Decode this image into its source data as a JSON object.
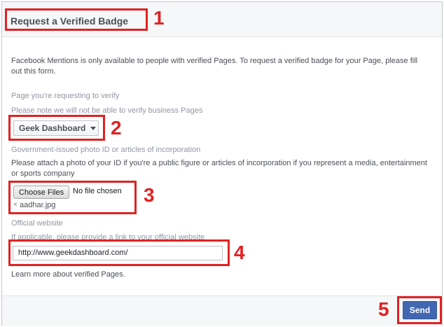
{
  "dialog": {
    "title": "Request a Verified Badge",
    "intro": "Facebook Mentions is only available to people with verified Pages. To request a verified badge for your Page, please fill out this form."
  },
  "page_section": {
    "heading": "Page you're requesting to verify",
    "note": "Please note we will not be able to verify business Pages",
    "selected_page": "Geek Dashboard"
  },
  "id_section": {
    "heading": "Government-issued photo ID or articles of incorporation",
    "note": "Please attach a photo of your ID if you're a public figure or articles of incorporation if you represent a media, entertainment or sports company",
    "choose_label": "Choose Files",
    "no_file_text": "No file chosen",
    "remove_glyph": "×",
    "attached_file": "aadhar.jpg"
  },
  "website_section": {
    "heading": "Official website",
    "note": "If applicable, please provide a link to your official website",
    "url_value": "http://www.geekdashboard.com/",
    "learn_more": "Learn more about verified Pages."
  },
  "footer": {
    "send_label": "Send"
  },
  "annotations": {
    "numbers": [
      "1",
      "2",
      "3",
      "4",
      "5"
    ],
    "color": "#e02222"
  },
  "colors": {
    "accent": "#4267b2",
    "header_bg": "#f6f7f9",
    "text": "#4b4f56",
    "muted": "#9197a3"
  }
}
